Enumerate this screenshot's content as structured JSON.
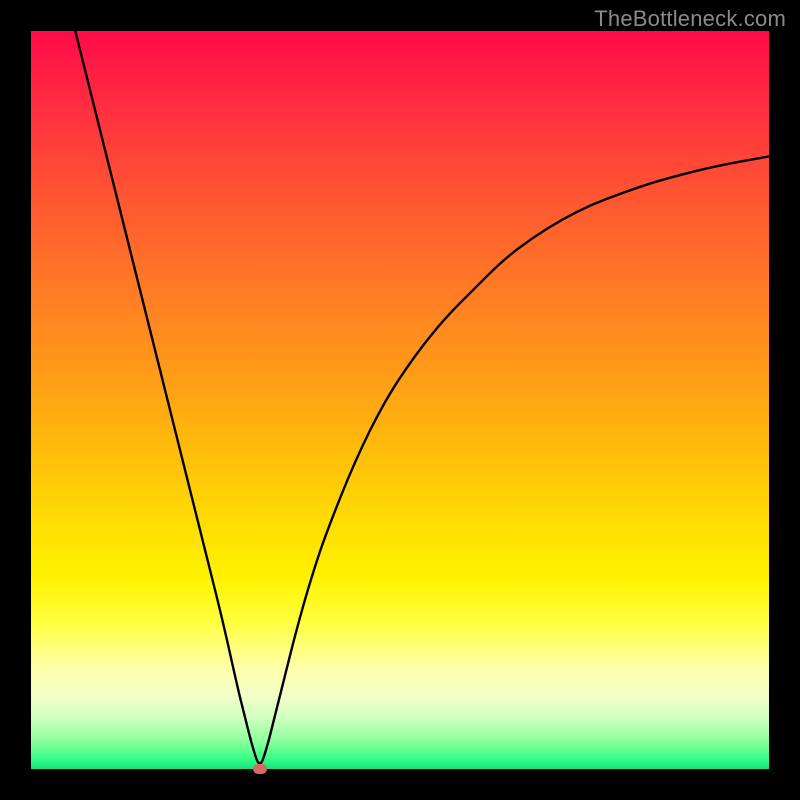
{
  "watermark": "TheBottleneck.com",
  "colors": {
    "page_bg": "#000000",
    "watermark": "#8a8a8a",
    "curve": "#000000",
    "dot": "#d66a63"
  },
  "chart_data": {
    "type": "line",
    "title": "",
    "xlabel": "",
    "ylabel": "",
    "xlim": [
      0,
      100
    ],
    "ylim": [
      0,
      100
    ],
    "grid": false,
    "legend": false,
    "bottleneck_x": 31,
    "series": [
      {
        "name": "bottleneck-curve",
        "x": [
          6,
          8,
          10,
          12,
          14,
          16,
          18,
          20,
          22,
          24,
          26,
          28,
          29,
          30,
          31,
          32,
          33,
          34,
          36,
          38,
          40,
          44,
          48,
          52,
          56,
          60,
          64,
          68,
          72,
          76,
          80,
          84,
          88,
          92,
          96,
          100
        ],
        "y": [
          100,
          92,
          84,
          76,
          68,
          60,
          52,
          44,
          36,
          28,
          20,
          11,
          7,
          3,
          0,
          3,
          7,
          11,
          19,
          26,
          32,
          42,
          50,
          56,
          61,
          65,
          69,
          72,
          74.5,
          76.5,
          78,
          79.4,
          80.5,
          81.5,
          82.3,
          83
        ]
      }
    ],
    "markers": [
      {
        "name": "bottleneck-point",
        "x": 31,
        "y": 0
      }
    ]
  }
}
